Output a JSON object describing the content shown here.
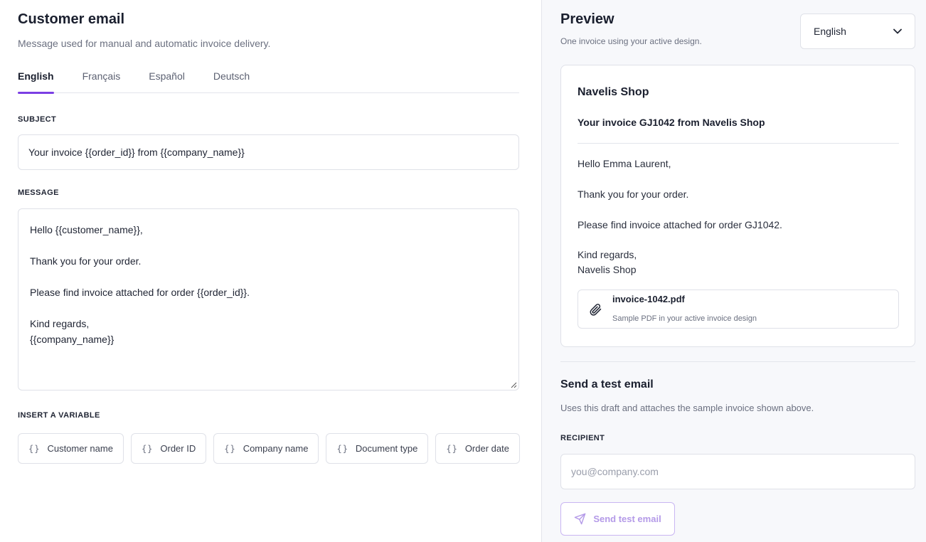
{
  "editor": {
    "title": "Customer email",
    "subtitle": "Message used for manual and automatic invoice delivery.",
    "tabs": [
      {
        "label": "English",
        "active": true
      },
      {
        "label": "Français",
        "active": false
      },
      {
        "label": "Español",
        "active": false
      },
      {
        "label": "Deutsch",
        "active": false
      }
    ],
    "subject_label": "SUBJECT",
    "subject_value": "Your invoice {{order_id}} from {{company_name}}",
    "message_label": "MESSAGE",
    "message_value": "Hello {{customer_name}},\n\nThank you for your order.\n\nPlease find invoice attached for order {{order_id}}.\n\nKind regards,\n{{company_name}}",
    "variables_label": "INSERT A VARIABLE",
    "variable_glyph": "{}",
    "variables": [
      "Customer name",
      "Order ID",
      "Company name",
      "Document type",
      "Order date"
    ]
  },
  "preview": {
    "title": "Preview",
    "subtitle": "One invoice using your active design.",
    "language": "English",
    "shop_name": "Navelis Shop",
    "subject": "Your invoice GJ1042 from Navelis Shop",
    "greeting": "Hello Emma Laurent,",
    "thanks": "Thank you for your order.",
    "attached_line": "Please find invoice attached for order GJ1042.",
    "signoff": "Kind regards,",
    "signature": "Navelis Shop",
    "attachment": {
      "icon": "paperclip-icon",
      "file_name": "invoice-1042.pdf",
      "description": "Sample PDF in your active invoice design"
    }
  },
  "test_email": {
    "title": "Send a test email",
    "subtitle": "Uses this draft and attaches the sample invoice shown above.",
    "recipient_label": "RECIPIENT",
    "recipient_placeholder": "you@company.com",
    "send_label": "Send test email",
    "send_icon": "paper-plane-icon"
  },
  "colors": {
    "accent": "#7b3fe4",
    "accent_disabled": "#b49ae8",
    "border": "#dfe1e8",
    "panel_bg": "#f7f8fb"
  }
}
